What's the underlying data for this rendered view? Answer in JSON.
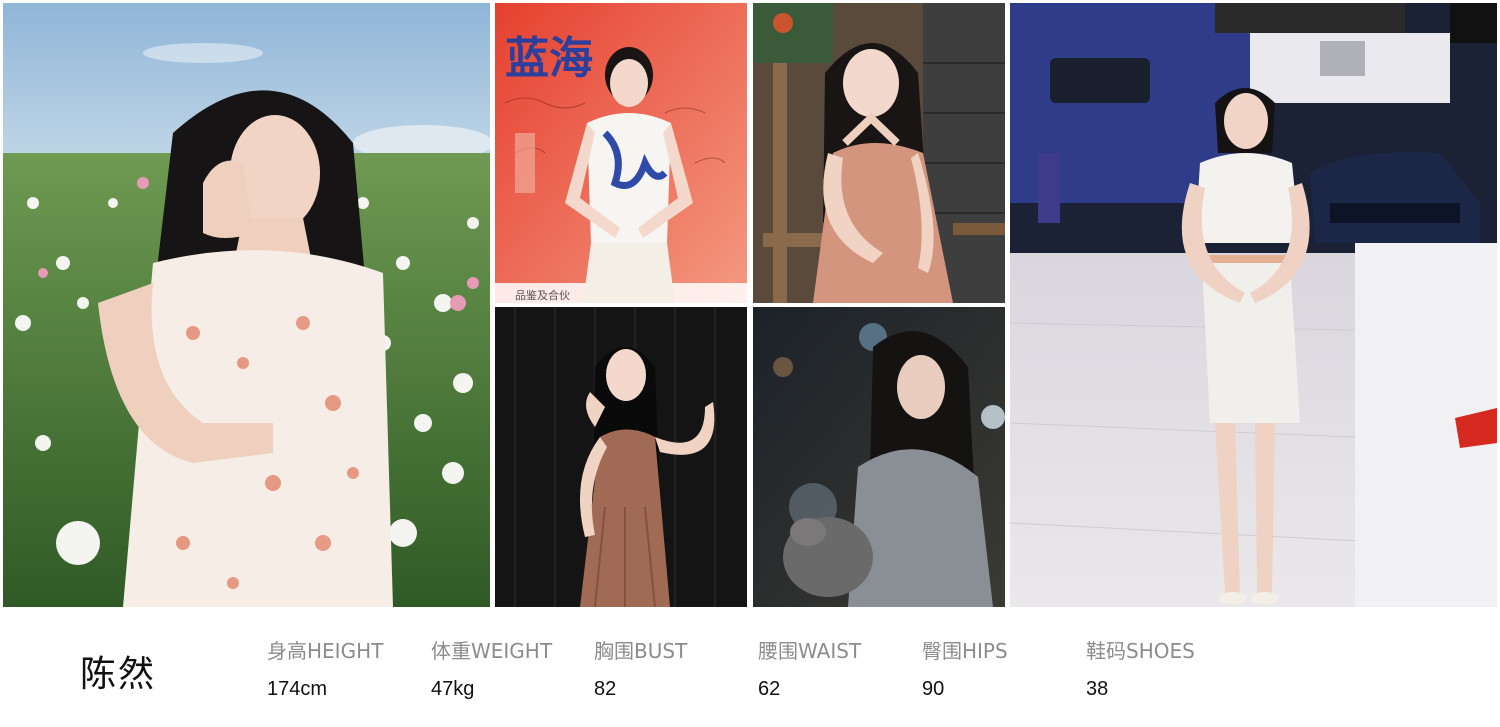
{
  "photo_panels": [
    {
      "subject": "woman in floral dress in field of cosmos flowers"
    },
    {
      "subject": "woman in blue-and-white qipao in front of red signed backdrop"
    },
    {
      "subject": "woman in pink halter dress seated on wooden chair"
    },
    {
      "subject": "woman in brown halter dress against dark background"
    },
    {
      "subject": "woman in grey cardigan holding plush toy at night"
    },
    {
      "subject": "woman in white dress at car show booth"
    }
  ],
  "backdrop_text": {
    "panel2_top": "蓝海",
    "panel2_bottom": "品鉴及合伙"
  },
  "profile": {
    "name": "陈然",
    "stats": [
      {
        "label": "身高HEIGHT",
        "value": "174cm"
      },
      {
        "label": "体重WEIGHT",
        "value": "47kg"
      },
      {
        "label": "胸围BUST",
        "value": "82"
      },
      {
        "label": "腰围WAIST",
        "value": "62"
      },
      {
        "label": "臀围HIPS",
        "value": "90"
      },
      {
        "label": "鞋码SHOES",
        "value": "38"
      }
    ]
  },
  "colors": {
    "label": "#8c8c8c",
    "value": "#111111"
  }
}
